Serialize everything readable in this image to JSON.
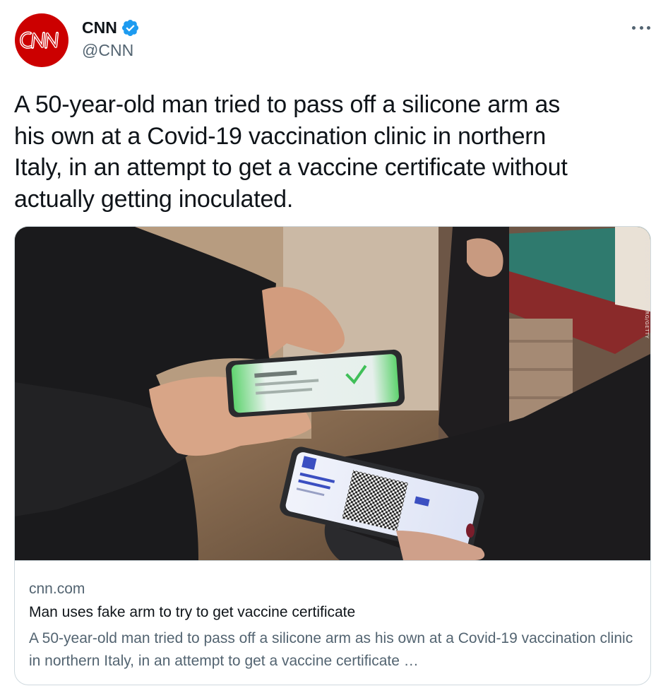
{
  "author": {
    "name": "CNN",
    "handle": "@CNN",
    "avatar_text": "CNN",
    "verified": true,
    "avatar_color": "#cc0000",
    "verified_color": "#1d9bf0"
  },
  "tweet": {
    "text": "A 50-year-old man tried to pass off a silicone arm as\nhis own at a Covid-19 vaccination clinic in northern\nItaly, in an attempt to get a vaccine certificate without\nactually getting inoculated."
  },
  "card": {
    "domain": "cnn.com",
    "title": "Man uses fake arm to try to get vaccine certificate",
    "description": "A 50-year-old man tried to pass off a silicone arm as his own at a Covid-19 vaccination clinic in northern Italy, in an attempt to get a vaccine certificate …",
    "photo_credit": "FRANCESCA VOLPI/BLOOMBERG/GETTY"
  },
  "icons": {
    "more": "more-horizontal-icon",
    "verified": "verified-badge-icon"
  }
}
